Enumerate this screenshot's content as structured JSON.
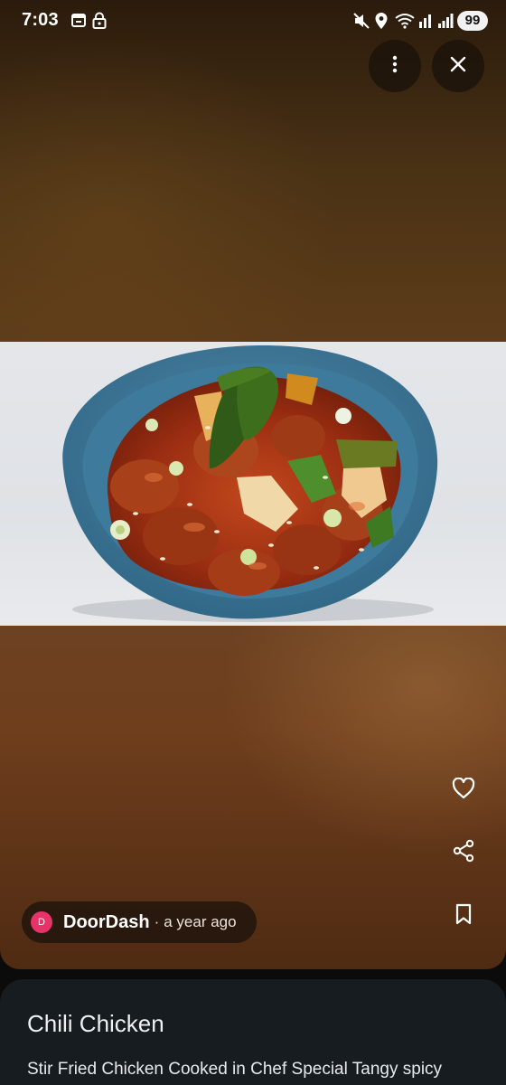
{
  "status_bar": {
    "time": "7:03",
    "battery": "99",
    "icons": [
      "calendar-icon",
      "lock-icon",
      "mute-icon",
      "location-icon",
      "wifi-icon",
      "signal-r-icon",
      "signal-icon"
    ]
  },
  "top_actions": {
    "more_icon": "more-vert-icon",
    "close_icon": "close-icon"
  },
  "photo": {
    "subject": "Chili Chicken"
  },
  "side_actions": [
    "heart-icon",
    "share-icon",
    "bookmark-icon"
  ],
  "attribution": {
    "avatar_letter": "D",
    "source": "DoorDash",
    "separator": "·",
    "time_ago": "a year ago",
    "avatar_color": "#e8336a"
  },
  "info": {
    "title": "Chili Chicken",
    "description": "Stir Fried Chicken Cooked in Chef Special Tangy spicy"
  }
}
